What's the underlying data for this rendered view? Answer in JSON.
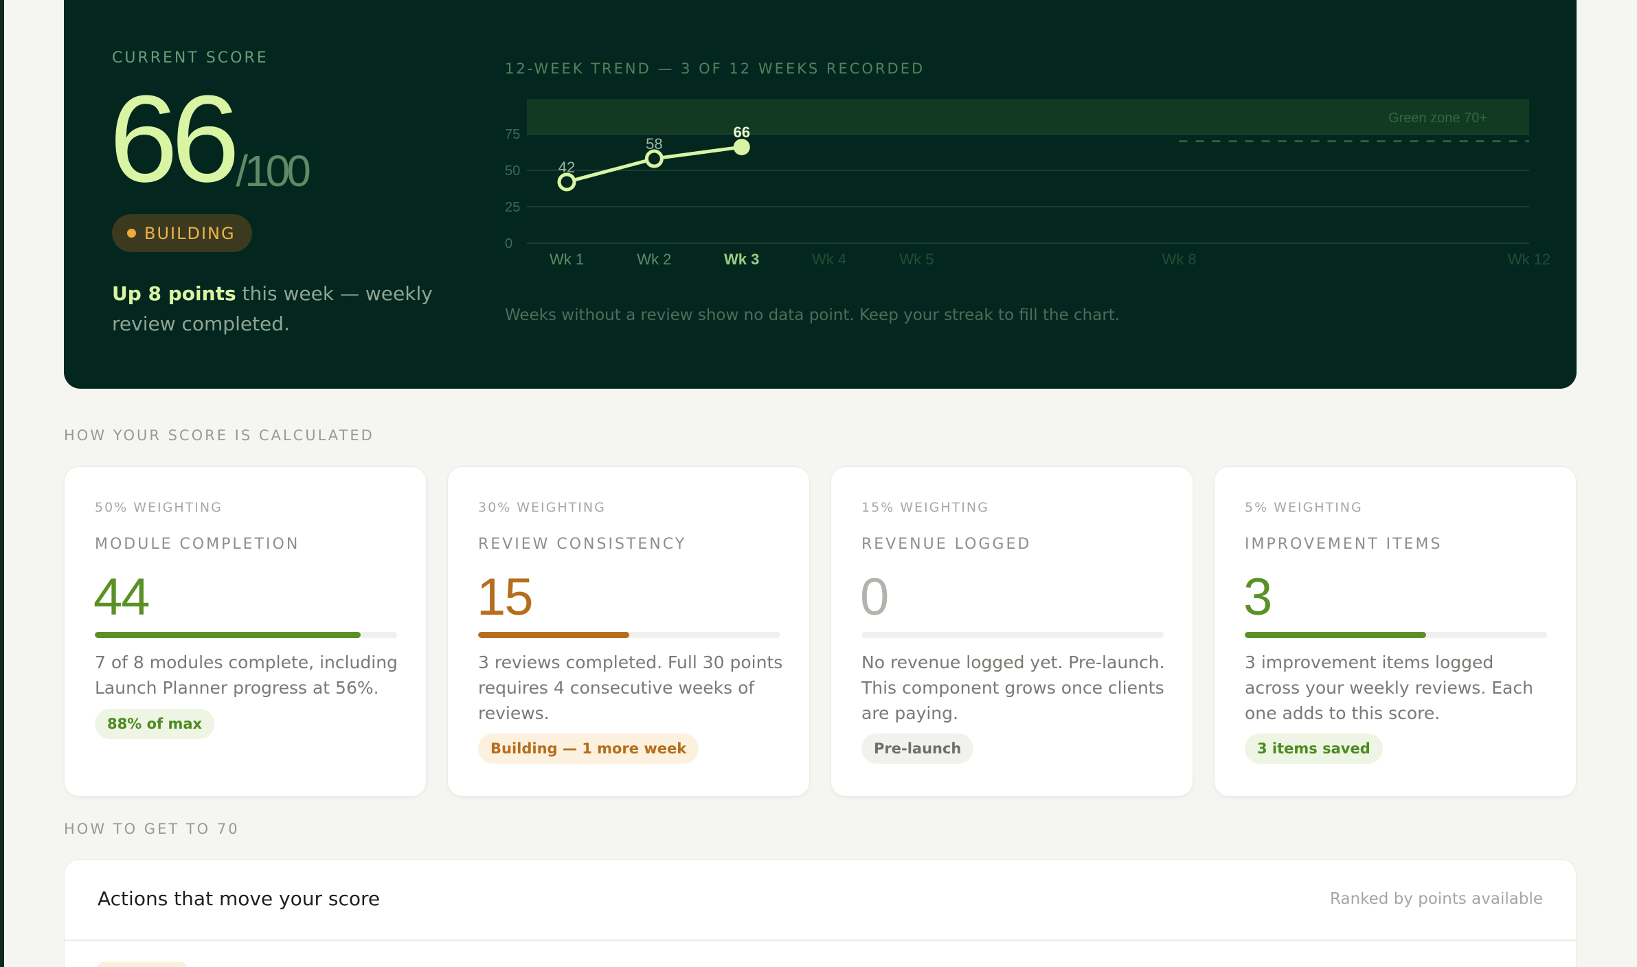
{
  "hero": {
    "current_label": "CURRENT SCORE",
    "score": "66",
    "score_max": "/100",
    "badge": "BUILDING",
    "delta_strong": "Up 8 points",
    "delta_rest": " this week — weekly review completed.",
    "trend_title": "12-WEEK TREND — 3 OF 12 WEEKS RECORDED",
    "chart_note": "Weeks without a review show no data point. Keep your streak to fill the chart."
  },
  "chart_data": {
    "type": "line",
    "x": [
      "Wk 1",
      "Wk 2",
      "Wk 3"
    ],
    "values": [
      42,
      58,
      66
    ],
    "x_tick_labels": [
      "Wk 1",
      "Wk 2",
      "Wk 3",
      "Wk 4",
      "Wk 5",
      "Wk 8",
      "Wk 12"
    ],
    "x_tick_weeks": [
      1,
      2,
      3,
      4,
      5,
      8,
      12
    ],
    "xlim": [
      1,
      12
    ],
    "y_ticks": [
      0,
      25,
      50,
      75
    ],
    "ylim": [
      0,
      75
    ],
    "green_zone": {
      "from": 70,
      "label": "Green zone 70+"
    },
    "target_line": {
      "value": 70,
      "from_week": 8
    },
    "colors": {
      "line": "#d9f5a4",
      "zone": "#123a22",
      "grid": "#1c3d31"
    }
  },
  "sections": {
    "calc_label": "HOW YOUR SCORE IS CALCULATED",
    "path_label": "HOW TO GET TO 70"
  },
  "cards": [
    {
      "weight": "50% WEIGHTING",
      "title": "MODULE COMPLETION",
      "value": "44",
      "progress": 0.88,
      "color": "#5a9126",
      "desc": "7 of 8 modules complete, including Launch Planner progress at 56%.",
      "pill": "88% of max",
      "pill_bg": "#eef5e4",
      "pill_color": "#4d8a1f"
    },
    {
      "weight": "30% WEIGHTING",
      "title": "REVIEW CONSISTENCY",
      "value": "15",
      "progress": 0.5,
      "color": "#b56e1d",
      "desc": "3 reviews completed. Full 30 points requires 4 consecutive weeks of reviews.",
      "pill": "Building — 1 more week",
      "pill_bg": "#fcf1df",
      "pill_color": "#b56e1d"
    },
    {
      "weight": "15% WEIGHTING",
      "title": "REVENUE LOGGED",
      "value": "0",
      "progress": 0,
      "color": "#b3b3ad",
      "desc": "No revenue logged yet. Pre-launch. This component grows once clients are paying.",
      "pill": "Pre-launch",
      "pill_bg": "#f1f1ee",
      "pill_color": "#6f6f6a"
    },
    {
      "weight": "5% WEIGHTING",
      "title": "IMPROVEMENT ITEMS",
      "value": "3",
      "progress": 0.6,
      "color": "#5a9126",
      "desc": "3 improvement items logged across your weekly reviews. Each one adds to this score.",
      "pill": "3 items saved",
      "pill_bg": "#eef5e4",
      "pill_color": "#4d8a1f"
    }
  ],
  "actions": {
    "title": "Actions that move your score",
    "note": "Ranked by points available"
  }
}
